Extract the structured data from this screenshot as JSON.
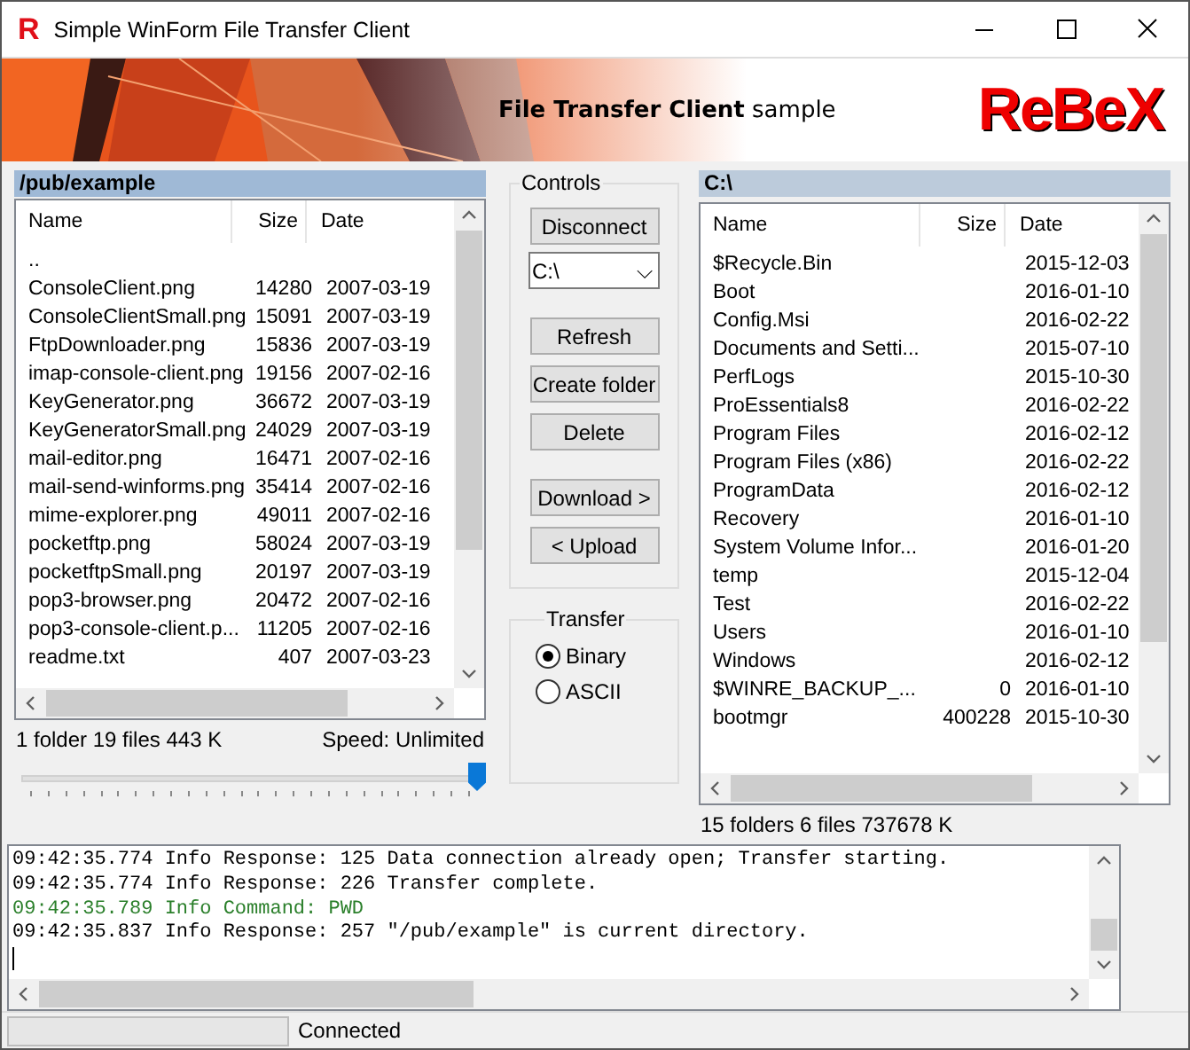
{
  "window": {
    "app_icon": "R",
    "title": "Simple WinForm File Transfer Client"
  },
  "banner": {
    "title": "**File Transfer Client** sample",
    "logo": "ReBeX"
  },
  "remote": {
    "path": "/pub/example",
    "columns": [
      "Name",
      "Size",
      "Date"
    ],
    "rows": [
      [
        "..",
        "",
        ""
      ],
      [
        "ConsoleClient.png",
        "14280",
        "2007-03-19"
      ],
      [
        "ConsoleClientSmall.png",
        "15091",
        "2007-03-19"
      ],
      [
        "FtpDownloader.png",
        "15836",
        "2007-03-19"
      ],
      [
        "imap-console-client.png",
        "19156",
        "2007-02-16"
      ],
      [
        "KeyGenerator.png",
        "36672",
        "2007-03-19"
      ],
      [
        "KeyGeneratorSmall.png",
        "24029",
        "2007-03-19"
      ],
      [
        "mail-editor.png",
        "16471",
        "2007-02-16"
      ],
      [
        "mail-send-winforms.png",
        "35414",
        "2007-02-16"
      ],
      [
        "mime-explorer.png",
        "49011",
        "2007-02-16"
      ],
      [
        "pocketftp.png",
        "58024",
        "2007-03-19"
      ],
      [
        "pocketftpSmall.png",
        "20197",
        "2007-03-19"
      ],
      [
        "pop3-browser.png",
        "20472",
        "2007-02-16"
      ],
      [
        "pop3-console-client.p...",
        "11205",
        "2007-02-16"
      ],
      [
        "readme.txt",
        "407",
        "2007-03-23"
      ]
    ],
    "summary": "1 folder 19 files 443 K",
    "speed": "Speed: Unlimited",
    "speed_slider": {
      "level": 1
    }
  },
  "controls": {
    "title": "Controls",
    "buttons": [
      "Disconnect"
    ],
    "drive": "C:\\",
    "caret": "⌵",
    "more_buttons": [
      "Refresh",
      "Create folder",
      "Delete"
    ],
    "transfer_buttons": [
      "Download >",
      "< Upload"
    ]
  },
  "transfer": {
    "title": "Transfer",
    "modes": [
      {
        "label": "Binary",
        "selected": true
      },
      {
        "label": "ASCII",
        "selected": false
      }
    ]
  },
  "local": {
    "path": "C:\\",
    "columns": [
      "Name",
      "Size",
      "Date"
    ],
    "rows": [
      [
        "$Recycle.Bin",
        "",
        "2015-12-03"
      ],
      [
        "Boot",
        "",
        "2016-01-10"
      ],
      [
        "Config.Msi",
        "",
        "2016-02-22"
      ],
      [
        "Documents and Setti...",
        "",
        "2015-07-10"
      ],
      [
        "PerfLogs",
        "",
        "2015-10-30"
      ],
      [
        "ProEssentials8",
        "",
        "2016-02-22"
      ],
      [
        "Program Files",
        "",
        "2016-02-12"
      ],
      [
        "Program Files (x86)",
        "",
        "2016-02-22"
      ],
      [
        "ProgramData",
        "",
        "2016-02-12"
      ],
      [
        "Recovery",
        "",
        "2016-01-10"
      ],
      [
        "System Volume Infor...",
        "",
        "2016-01-20"
      ],
      [
        "temp",
        "",
        "2015-12-04"
      ],
      [
        "Test",
        "",
        "2016-02-22"
      ],
      [
        "Users",
        "",
        "2016-01-10"
      ],
      [
        "Windows",
        "",
        "2016-02-12"
      ],
      [
        "$WINRE_BACKUP_...",
        "0",
        "2016-01-10"
      ],
      [
        "bootmgr",
        "400228",
        "2015-10-30"
      ]
    ],
    "summary": "15 folders 6 files 737678 K"
  },
  "log": [
    {
      "text": "09:42:35.774 Info Response: 125 Data connection already open; Transfer starting.",
      "kind": "response"
    },
    {
      "text": "09:42:35.774 Info Response: 226 Transfer complete.",
      "kind": "response"
    },
    {
      "text": "09:42:35.789 Info Command: PWD",
      "kind": "command"
    },
    {
      "text": "09:42:35.837 Info Response: 257 \"/pub/example\" is current directory.",
      "kind": "response"
    }
  ],
  "status_bar": {
    "progress": {
      "level": 0
    },
    "text": "Connected"
  }
}
